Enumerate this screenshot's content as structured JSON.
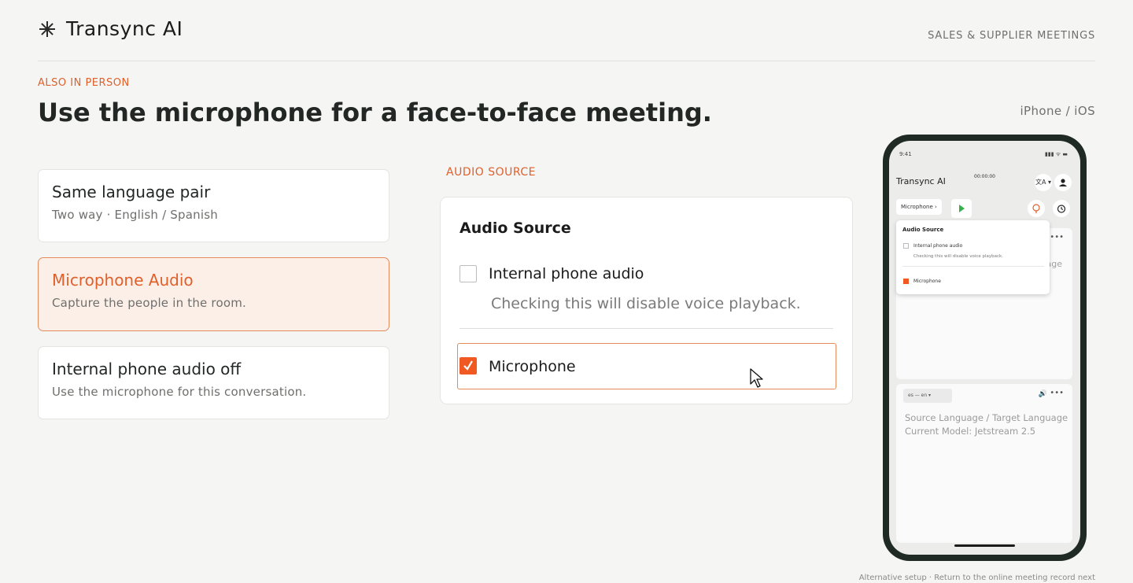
{
  "header": {
    "brand": "Transync AI",
    "nav_right": "SALES & SUPPLIER MEETINGS"
  },
  "hero": {
    "eyebrow": "ALSO IN PERSON",
    "title": "Use the microphone for a face-to-face meeting.",
    "platform": "iPhone / iOS"
  },
  "options": [
    {
      "title": "Same language pair",
      "subtitle": "Two way · English / Spanish",
      "active": false
    },
    {
      "title": "Microphone Audio",
      "subtitle": "Capture the people in the room.",
      "active": true
    },
    {
      "title": "Internal phone audio off",
      "subtitle": "Use the microphone for this conversation.",
      "active": false
    }
  ],
  "audio_source": {
    "section_label": "AUDIO SOURCE",
    "card_title": "Audio Source",
    "internal_label": "Internal phone audio",
    "internal_checked": false,
    "internal_note": "Checking this will disable voice playback.",
    "microphone_label": "Microphone",
    "microphone_checked": true
  },
  "phone": {
    "status_time": "9:41",
    "status_icons": "▮▮▮ ᯤ ▬",
    "app_title": "Transync AI",
    "timer": "00:00:00",
    "translate_icon_label": "文A ▾",
    "mic_button": "Microphone  ›",
    "panel_ghost": "age",
    "popover": {
      "title": "Audio Source",
      "internal_label": "Internal phone audio",
      "note": "Checking this will disable voice playback.",
      "mic_label": "Microphone"
    },
    "lang_selector": "es — en  ▾",
    "source_target": "Source Language / Target Language",
    "model": "Current Model: Jetstream 2.5"
  },
  "footer": {
    "note": "Alternative setup · Return to the online meeting record next"
  },
  "colors": {
    "accent": "#e0602c",
    "checkbox_checked": "#f05a22",
    "play_green": "#35b04a"
  }
}
